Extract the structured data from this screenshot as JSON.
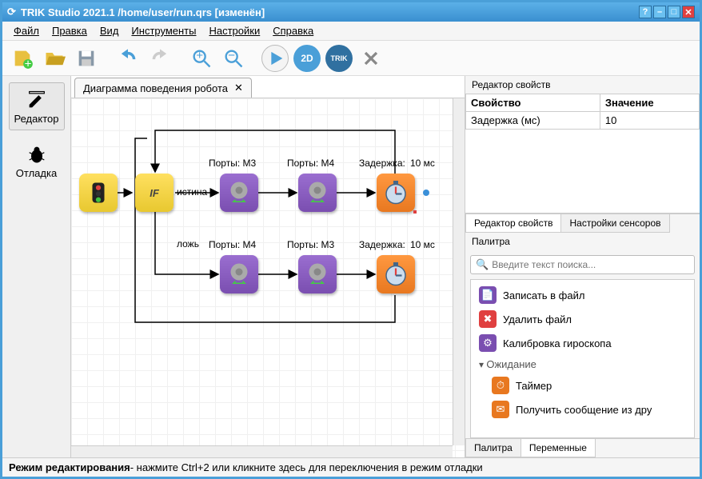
{
  "window": {
    "title": "TRIK Studio 2021.1 /home/user/run.qrs [изменён]"
  },
  "menu": {
    "file": "Файл",
    "edit": "Правка",
    "view": "Вид",
    "tools": "Инструменты",
    "settings": "Настройки",
    "help": "Справка"
  },
  "modes": {
    "editor": "Редактор",
    "debug": "Отладка"
  },
  "tab": {
    "title": "Диаграмма поведения робота"
  },
  "diagram": {
    "true_label": "истина",
    "false_label": "ложь",
    "port_m3_1": "Порты: M3",
    "port_m4_1": "Порты: M4",
    "port_m4_2": "Порты: M4",
    "port_m3_2": "Порты: M3",
    "delay_lbl_1": "Задержка:",
    "delay_lbl_2": "Задержка:",
    "delay_val_1": "10 мс",
    "delay_val_2": "10 мс",
    "if_text": "IF"
  },
  "props": {
    "title": "Редактор свойств",
    "col_prop": "Свойство",
    "col_val": "Значение",
    "row1_key": "Задержка (мс)",
    "row1_val": "10",
    "tab_props": "Редактор свойств",
    "tab_sensors": "Настройки сенсоров"
  },
  "palette": {
    "title": "Палитра",
    "search_placeholder": "Введите текст поиска...",
    "items": {
      "write_file": "Записать в файл",
      "delete_file": "Удалить файл",
      "gyro_calib": "Калибровка  гироскопа",
      "cat_wait": "Ожидание",
      "timer": "Таймер",
      "recv_msg": "Получить сообщение из дру"
    },
    "tab_palette": "Палитра",
    "tab_vars": "Переменные"
  },
  "status": {
    "mode": "Режим редактирования",
    "hint": " - нажмите Ctrl+2 или кликните здесь для переключения в режим отладки"
  }
}
